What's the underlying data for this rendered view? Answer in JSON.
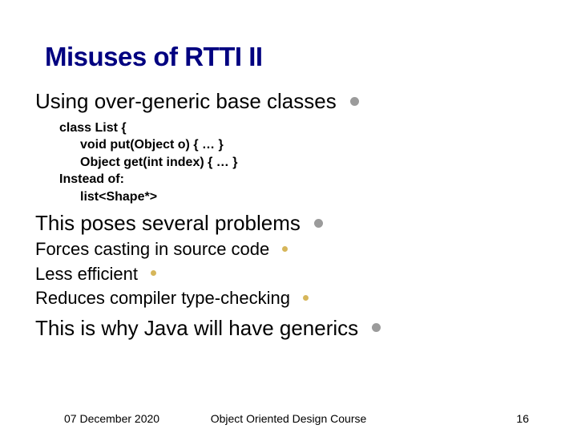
{
  "title": "Misuses of RTTI II",
  "bullets": {
    "b1": "Using over-generic base classes",
    "b2": "This poses several problems",
    "b3": "This is why Java will have generics"
  },
  "sub": {
    "s1": "Forces casting in source code",
    "s2": "Less efficient",
    "s3": "Reduces compiler type-checking"
  },
  "code": {
    "l1": "class List {",
    "l2": "void put(Object o) { … }",
    "l3": "Object get(int index) { … }",
    "l4": "Instead of:",
    "l5": "list<Shape*>"
  },
  "footer": {
    "date": "07 December 2020",
    "course": "Object Oriented Design Course",
    "page": "16"
  }
}
